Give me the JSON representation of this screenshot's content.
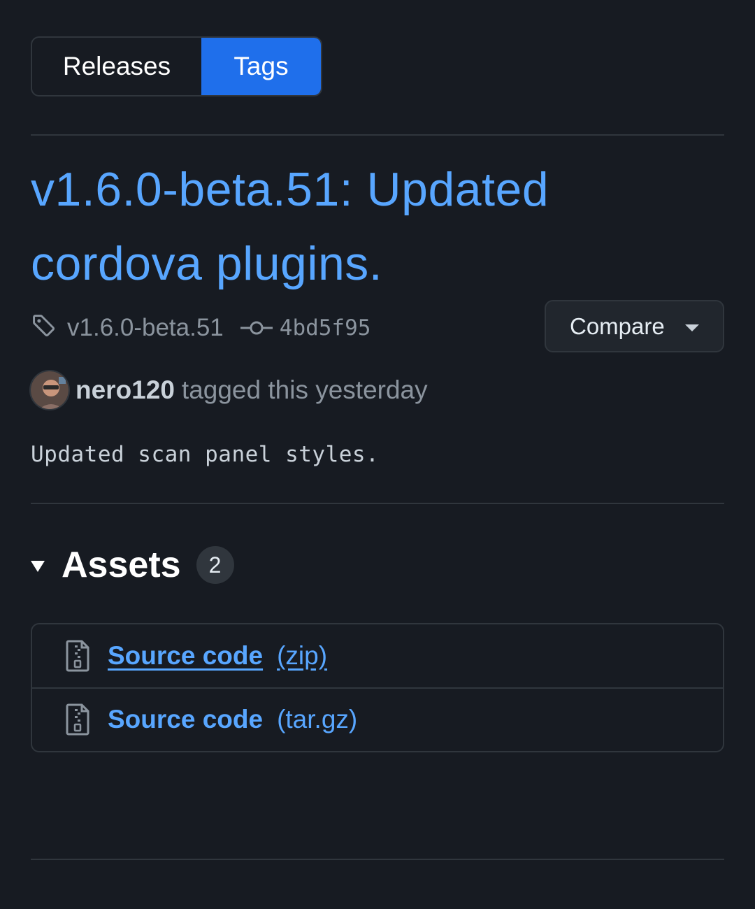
{
  "tabs": {
    "releases": "Releases",
    "tags": "Tags",
    "active": "Tags"
  },
  "release": {
    "title": "v1.6.0-beta.51: Updated cordova plugins.",
    "tag": "v1.6.0-beta.51",
    "commit": "4bd5f95",
    "compare_label": "Compare",
    "author": "nero120",
    "action_text": "tagged this yesterday",
    "body": "Updated scan panel styles."
  },
  "assets": {
    "title": "Assets",
    "count": "2",
    "items": [
      {
        "label": "Source code",
        "ext": "(zip)"
      },
      {
        "label": "Source code",
        "ext": "(tar.gz)"
      }
    ]
  },
  "colors": {
    "background": "#171b22",
    "accent_blue": "#1f6feb",
    "link_blue": "#58a6ff",
    "border": "#30363d",
    "muted_text": "#8b949e"
  }
}
